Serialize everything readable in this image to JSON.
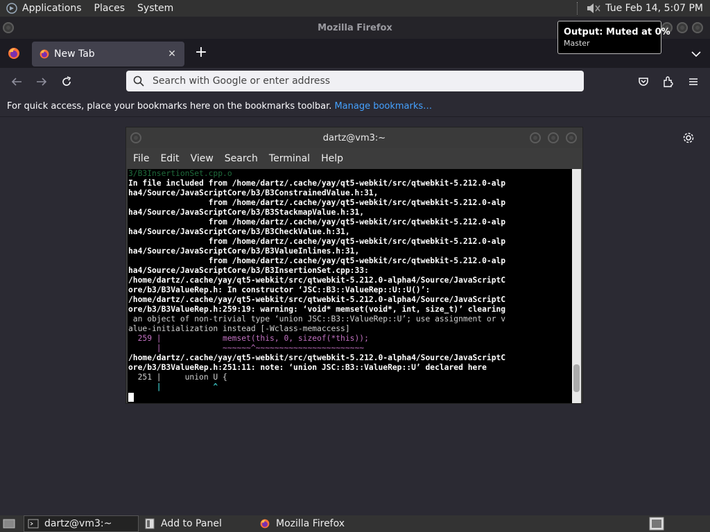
{
  "top_panel": {
    "menus": [
      "Applications",
      "Places",
      "System"
    ],
    "clock": "Tue Feb 14,  5:07 PM"
  },
  "window_title": "Mozilla Firefox",
  "tooltip": {
    "title": "Output: Muted at 0%",
    "subtitle": "Master"
  },
  "tabs": [
    {
      "title": "New Tab"
    }
  ],
  "urlbar": {
    "placeholder": "Search with Google or enter address"
  },
  "bookmarks_bar": {
    "message": "For quick access, place your bookmarks here on the bookmarks toolbar.",
    "link": "Manage bookmarks…"
  },
  "terminal": {
    "title": "dartz@vm3:~",
    "menus": [
      "File",
      "Edit",
      "View",
      "Search",
      "Terminal",
      "Help"
    ],
    "lines": [
      "3/B3InsertionSet.cpp.o",
      "In file included from /home/dartz/.cache/yay/qt5-webkit/src/qtwebkit-5.212.0-alp",
      "ha4/Source/JavaScriptCore/b3/B3ConstrainedValue.h:31,",
      "                 from /home/dartz/.cache/yay/qt5-webkit/src/qtwebkit-5.212.0-alp",
      "ha4/Source/JavaScriptCore/b3/B3StackmapValue.h:31,",
      "                 from /home/dartz/.cache/yay/qt5-webkit/src/qtwebkit-5.212.0-alp",
      "ha4/Source/JavaScriptCore/b3/B3CheckValue.h:31,",
      "                 from /home/dartz/.cache/yay/qt5-webkit/src/qtwebkit-5.212.0-alp",
      "ha4/Source/JavaScriptCore/b3/B3ValueInlines.h:31,",
      "                 from /home/dartz/.cache/yay/qt5-webkit/src/qtwebkit-5.212.0-alp",
      "ha4/Source/JavaScriptCore/b3/B3InsertionSet.cpp:33:",
      "/home/dartz/.cache/yay/qt5-webkit/src/qtwebkit-5.212.0-alpha4/Source/JavaScriptC",
      "ore/b3/B3ValueRep.h: In constructor ‘JSC::B3::ValueRep::U::U()’:",
      "/home/dartz/.cache/yay/qt5-webkit/src/qtwebkit-5.212.0-alpha4/Source/JavaScriptC",
      "ore/b3/B3ValueRep.h:259:19: warning: ‘void* memset(void*, int, size_t)’ clearing",
      " an object of non-trivial type ‘union JSC::B3::ValueRep::U’; use assignment or v",
      "alue-initialization instead [-Wclass-memaccess]",
      "  259 |             memset(this, 0, sizeof(*this));",
      "      |             ~~~~~~^~~~~~~~~~~~~~~~~~~~~~~~",
      "/home/dartz/.cache/yay/qt5-webkit/src/qtwebkit-5.212.0-alpha4/Source/JavaScriptC",
      "ore/b3/B3ValueRep.h:251:11: note: ‘union JSC::B3::ValueRep::U’ declared here",
      "  251 |     union U {",
      "      |           ^"
    ]
  },
  "taskbar": {
    "items": [
      "dartz@vm3:~",
      "Add to Panel",
      "Mozilla Firefox"
    ]
  },
  "colors": {
    "accent_link": "#45a1ff",
    "terminal_bg": "#000000",
    "firefox_bg": "#2b2a33"
  }
}
